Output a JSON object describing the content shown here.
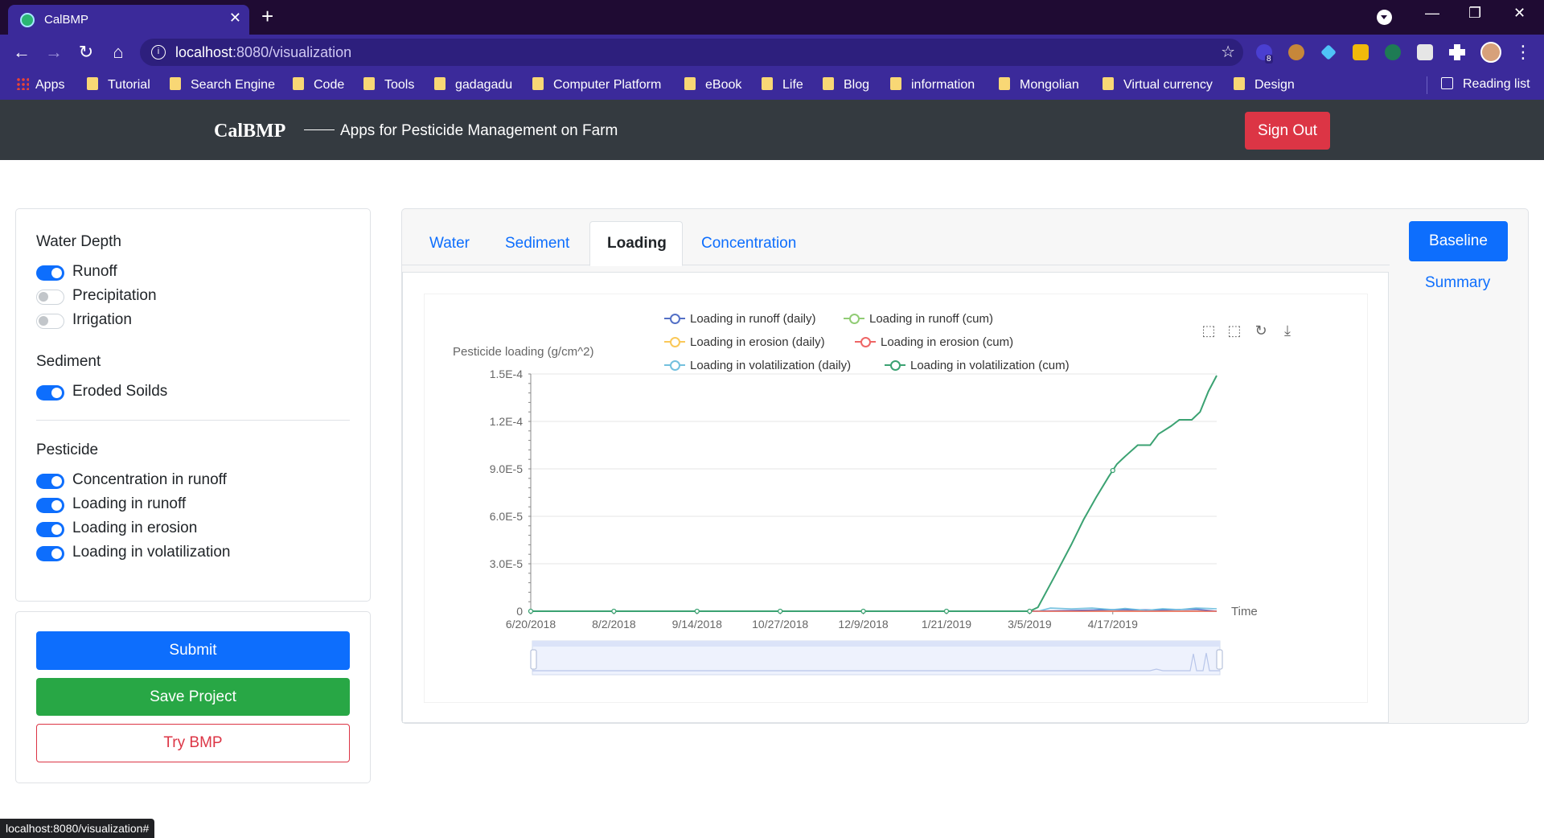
{
  "browser": {
    "tab_title": "CalBMP",
    "url_host": "localhost",
    "url_rest": ":8080/visualization",
    "ext_badge": "8",
    "bookmarks": [
      "Apps",
      "Tutorial",
      "Search Engine",
      "Code",
      "Tools",
      "gadagadu",
      "Computer Platform",
      "eBook",
      "Life",
      "Blog",
      "information",
      "Mongolian",
      "Virtual currency",
      "Design"
    ],
    "reading_list": "Reading list",
    "status_url": "localhost:8080/visualization#"
  },
  "header": {
    "brand": "CalBMP",
    "subtitle": "Apps for Pesticide Management on Farm",
    "sign_out": "Sign Out"
  },
  "controls": {
    "water_title": "Water Depth",
    "water": [
      {
        "label": "Runoff",
        "on": true
      },
      {
        "label": "Precipitation",
        "on": false
      },
      {
        "label": "Irrigation",
        "on": false
      }
    ],
    "sediment_title": "Sediment",
    "sediment": [
      {
        "label": "Eroded Soilds",
        "on": true
      }
    ],
    "pesticide_title": "Pesticide",
    "pesticide": [
      {
        "label": "Concentration in runoff",
        "on": true
      },
      {
        "label": "Loading in runoff",
        "on": true
      },
      {
        "label": "Loading in erosion",
        "on": true
      },
      {
        "label": "Loading in volatilization",
        "on": true
      }
    ],
    "submit": "Submit",
    "save": "Save Project",
    "try_bmp": "Try BMP"
  },
  "main": {
    "tabs": [
      "Water",
      "Sediment",
      "Loading",
      "Concentration"
    ],
    "active_tab": "Loading",
    "baseline": "Baseline",
    "summary": "Summary"
  },
  "chart_data": {
    "type": "line",
    "title": "",
    "ylabel": "Pesticide loading (g/cm^2)",
    "xlabel": "Time",
    "ylim": [
      0,
      0.00015
    ],
    "yticks": [
      "0",
      "3.0E-5",
      "6.0E-5",
      "9.0E-5",
      "1.2E-4",
      "1.5E-4"
    ],
    "xticks": [
      "6/20/2018",
      "8/2/2018",
      "9/14/2018",
      "10/27/2018",
      "12/9/2018",
      "1/21/2019",
      "3/5/2019",
      "4/17/2019"
    ],
    "legend_position": "top",
    "series": [
      {
        "name": "Loading in runoff (daily)",
        "color": "#5470c6",
        "values": [
          [
            0,
            0
          ],
          [
            12,
            0
          ],
          [
            13,
            5e-07
          ],
          [
            14,
            1e-06
          ],
          [
            15,
            8e-07
          ],
          [
            16,
            1.2e-06
          ],
          [
            16.5,
            0
          ]
        ]
      },
      {
        "name": "Loading in runoff (cum)",
        "color": "#91cc75",
        "values": [
          [
            0,
            0
          ],
          [
            16.5,
            0
          ]
        ]
      },
      {
        "name": "Loading in erosion (daily)",
        "color": "#fac858",
        "values": [
          [
            0,
            0
          ],
          [
            16.5,
            0
          ]
        ]
      },
      {
        "name": "Loading in erosion (cum)",
        "color": "#ee6666",
        "values": [
          [
            0,
            0
          ],
          [
            16.5,
            0
          ]
        ]
      },
      {
        "name": "Loading in volatilization (daily)",
        "color": "#73c0de",
        "values": [
          [
            0,
            0
          ],
          [
            12.2,
            0
          ],
          [
            12.5,
            2e-06
          ],
          [
            13,
            1.5e-06
          ],
          [
            13.5,
            2e-06
          ],
          [
            14,
            1e-06
          ],
          [
            14.3,
            1.8e-06
          ],
          [
            14.8,
            5e-07
          ],
          [
            15.2,
            1.6e-06
          ],
          [
            15.6,
            1e-06
          ],
          [
            16,
            2e-06
          ],
          [
            16.3,
            1.8e-06
          ],
          [
            16.5,
            1.5e-06
          ]
        ]
      },
      {
        "name": "Loading in volatilization (cum)",
        "color": "#3ba272",
        "values": [
          [
            0,
            0
          ],
          [
            12.0,
            0
          ],
          [
            12.2,
            2.5e-06
          ],
          [
            12.6,
            2.2e-05
          ],
          [
            13.0,
            4.2e-05
          ],
          [
            13.3,
            5.8e-05
          ],
          [
            13.6,
            7.2e-05
          ],
          [
            13.9,
            8.5e-05
          ],
          [
            14.1,
            9.3e-05
          ],
          [
            14.3,
            9.8e-05
          ],
          [
            14.6,
            0.000105
          ],
          [
            14.9,
            0.000105
          ],
          [
            15.1,
            0.000112
          ],
          [
            15.4,
            0.000117
          ],
          [
            15.6,
            0.000121
          ],
          [
            15.9,
            0.000121
          ],
          [
            16.1,
            0.000126
          ],
          [
            16.3,
            0.000139
          ],
          [
            16.5,
            0.000149
          ]
        ]
      }
    ]
  }
}
